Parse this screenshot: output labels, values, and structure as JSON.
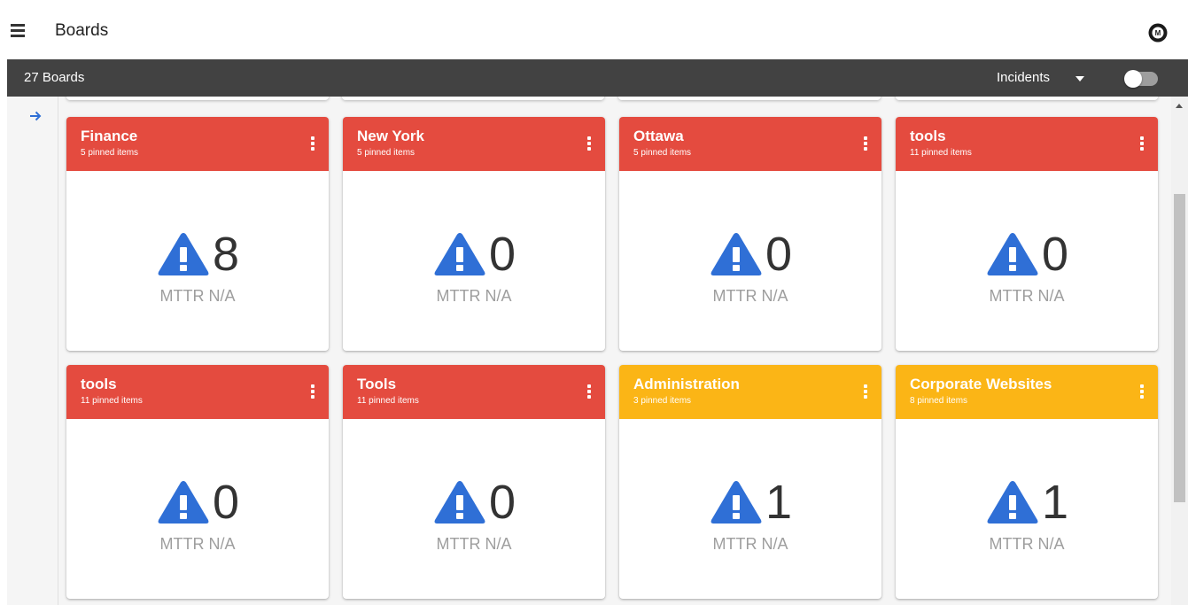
{
  "header": {
    "title": "Boards",
    "menu_icon": "hamburger-menu-icon",
    "logo_icon": "company-logo-icon"
  },
  "toolbar": {
    "board_count": "27 Boards",
    "view_select": "Incidents",
    "toggle_on": false
  },
  "colors": {
    "red": "#e44b3f",
    "amber": "#fbb516",
    "toolbar": "#424242",
    "icon_blue": "#2f6fd6"
  },
  "cards": [
    {
      "title": "Finance",
      "subtitle": "5 pinned items",
      "value": "8",
      "mttr": "MTTR N/A",
      "status": "red"
    },
    {
      "title": "New York",
      "subtitle": "5 pinned items",
      "value": "0",
      "mttr": "MTTR N/A",
      "status": "red"
    },
    {
      "title": "Ottawa",
      "subtitle": "5 pinned items",
      "value": "0",
      "mttr": "MTTR N/A",
      "status": "red"
    },
    {
      "title": "tools",
      "subtitle": "11 pinned items",
      "value": "0",
      "mttr": "MTTR N/A",
      "status": "red"
    },
    {
      "title": "tools",
      "subtitle": "11 pinned items",
      "value": "0",
      "mttr": "MTTR N/A",
      "status": "red"
    },
    {
      "title": "Tools",
      "subtitle": "11 pinned items",
      "value": "0",
      "mttr": "MTTR N/A",
      "status": "red"
    },
    {
      "title": "Administration",
      "subtitle": "3 pinned items",
      "value": "1",
      "mttr": "MTTR N/A",
      "status": "amber"
    },
    {
      "title": "Corporate Websites",
      "subtitle": "8 pinned items",
      "value": "1",
      "mttr": "MTTR N/A",
      "status": "amber"
    }
  ]
}
